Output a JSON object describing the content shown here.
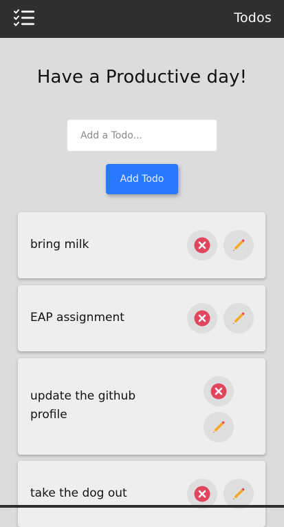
{
  "navbar": {
    "logo_icon": "checklist-icon",
    "title": "Todos"
  },
  "main": {
    "headline": "Have a Productive day!",
    "input": {
      "placeholder": "Add a Todo...",
      "value": ""
    },
    "add_button_label": "Add Todo"
  },
  "todos": [
    {
      "text": "bring milk",
      "delete_icon": "delete-x-icon",
      "edit_icon": "pencil-icon"
    },
    {
      "text": "EAP assignment",
      "delete_icon": "delete-x-icon",
      "edit_icon": "pencil-icon"
    },
    {
      "text": "update the github profile",
      "delete_icon": "delete-x-icon",
      "edit_icon": "pencil-icon"
    },
    {
      "text": "take the dog out",
      "delete_icon": "delete-x-icon",
      "edit_icon": "pencil-icon"
    }
  ],
  "colors": {
    "navbar": "#2f2f2f",
    "background": "#dcdcdc",
    "accent": "#2979ff",
    "card": "#eeeeee",
    "delete": "#e0475f",
    "edit": "#f5a623"
  }
}
